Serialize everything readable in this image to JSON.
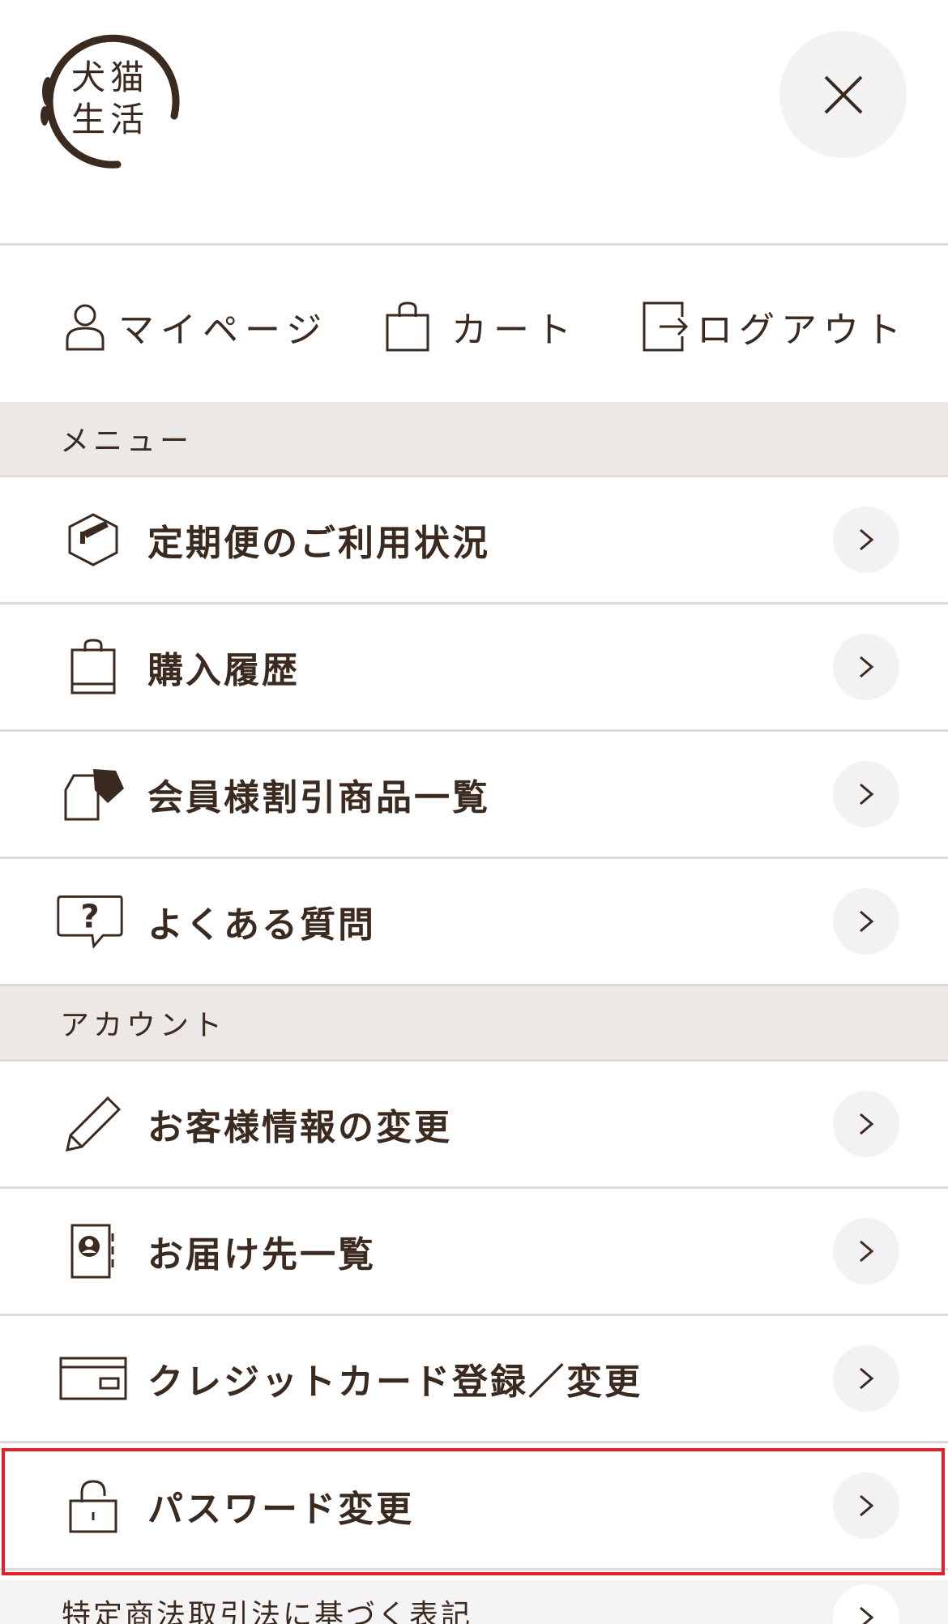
{
  "header": {
    "logo_text_line1": "犬猫",
    "logo_text_line2": "生活",
    "close_label": "×"
  },
  "quick_links": [
    {
      "label": "マイページ",
      "icon": "user-icon"
    },
    {
      "label": "カート",
      "icon": "shopping-bag-icon"
    },
    {
      "label": "ログアウト",
      "icon": "logout-icon"
    }
  ],
  "sections": {
    "menu": "メニュー",
    "account": "アカウント"
  },
  "menu_items": [
    {
      "label": "定期便のご利用状況",
      "icon": "box-icon"
    },
    {
      "label": "購入履歴",
      "icon": "shopping-bag-icon"
    },
    {
      "label": "会員様割引商品一覧",
      "icon": "discount-tag-icon"
    },
    {
      "label": "よくある質問",
      "icon": "question-bubble-icon"
    }
  ],
  "account_items": [
    {
      "label": "お客様情報の変更",
      "icon": "pencil-icon"
    },
    {
      "label": "お届け先一覧",
      "icon": "address-book-icon"
    },
    {
      "label": "クレジットカード登録／変更",
      "icon": "credit-card-icon"
    },
    {
      "label": "パスワード変更",
      "icon": "lock-icon"
    }
  ],
  "footer": {
    "label": "特定商法取引法に基づく表記"
  },
  "colors": {
    "text": "#3b2a1f",
    "section_bg": "#ebe8e6",
    "highlight": "#e0202c"
  }
}
